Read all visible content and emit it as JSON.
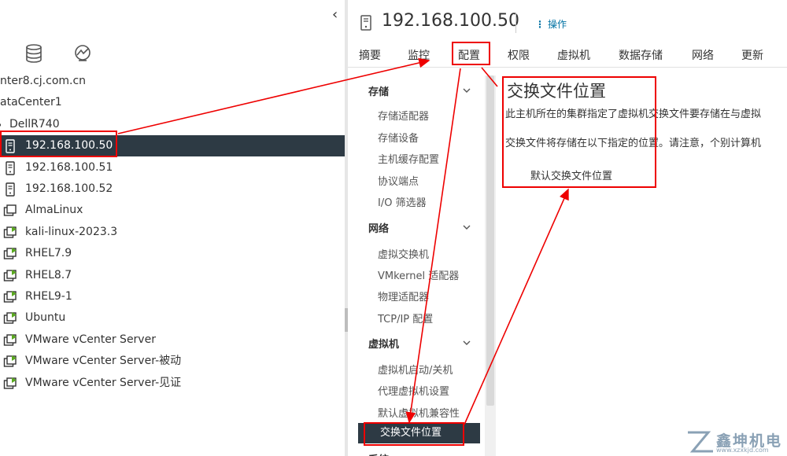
{
  "left_panel": {
    "collapse_icon": "chevron-left-icon",
    "toolbar_icons": [
      "database-icon",
      "network-icon"
    ],
    "tree": [
      {
        "label": "nter8.cj.com.cn",
        "icon": "",
        "top": true
      },
      {
        "label": "ataCenter1",
        "icon": "",
        "top": true
      },
      {
        "label": "DellR740",
        "icon": "cluster-icon",
        "top": true
      },
      {
        "label": "192.168.100.50",
        "icon": "host-icon",
        "selected": true
      },
      {
        "label": "192.168.100.51",
        "icon": "host-icon"
      },
      {
        "label": "192.168.100.52",
        "icon": "host-icon"
      },
      {
        "label": "AlmaLinux",
        "icon": "vm-icon"
      },
      {
        "label": "kali-linux-2023.3",
        "icon": "vm-running-icon"
      },
      {
        "label": "RHEL7.9",
        "icon": "vm-running-icon"
      },
      {
        "label": "RHEL8.7",
        "icon": "vm-running-icon"
      },
      {
        "label": "RHEL9-1",
        "icon": "vm-running-icon"
      },
      {
        "label": "Ubuntu",
        "icon": "vm-running-icon"
      },
      {
        "label": "VMware vCenter Server",
        "icon": "vm-running-icon"
      },
      {
        "label": "VMware vCenter Server-被动",
        "icon": "vm-running-icon"
      },
      {
        "label": "VMware vCenter Server-见证",
        "icon": "vm-running-icon"
      }
    ]
  },
  "header": {
    "title": "192.168.100.50",
    "actions_label": "操作"
  },
  "tabs": [
    "摘要",
    "监控",
    "配置",
    "权限",
    "虚拟机",
    "数据存储",
    "网络",
    "更新"
  ],
  "nav": {
    "groups": [
      {
        "label": "存储",
        "items": [
          "存储适配器",
          "存储设备",
          "主机缓存配置",
          "协议端点",
          "I/O 筛选器"
        ]
      },
      {
        "label": "网络",
        "items": [
          "虚拟交换机",
          "VMkernel 适配器",
          "物理适配器",
          "TCP/IP 配置"
        ]
      },
      {
        "label": "虚拟机",
        "items": [
          "虚拟机启动/关机",
          "代理虚拟机设置",
          "默认虚拟机兼容性",
          "交换文件位置"
        ]
      }
    ],
    "next_group_label": "系统"
  },
  "content": {
    "title": "交换文件位置",
    "paragraph1": "此主机所在的集群指定了虚拟机交换文件要存储在与虚拟",
    "paragraph2": "交换文件将存储在以下指定的位置。请注意，个别计算机",
    "default_label": "默认交换文件位置"
  },
  "watermark": {
    "text": "鑫坤机电",
    "url": "www.xzxkjd.com"
  },
  "colors": {
    "selection": "#2d3a44",
    "annotation": "#e00000",
    "link": "#0072a3"
  }
}
